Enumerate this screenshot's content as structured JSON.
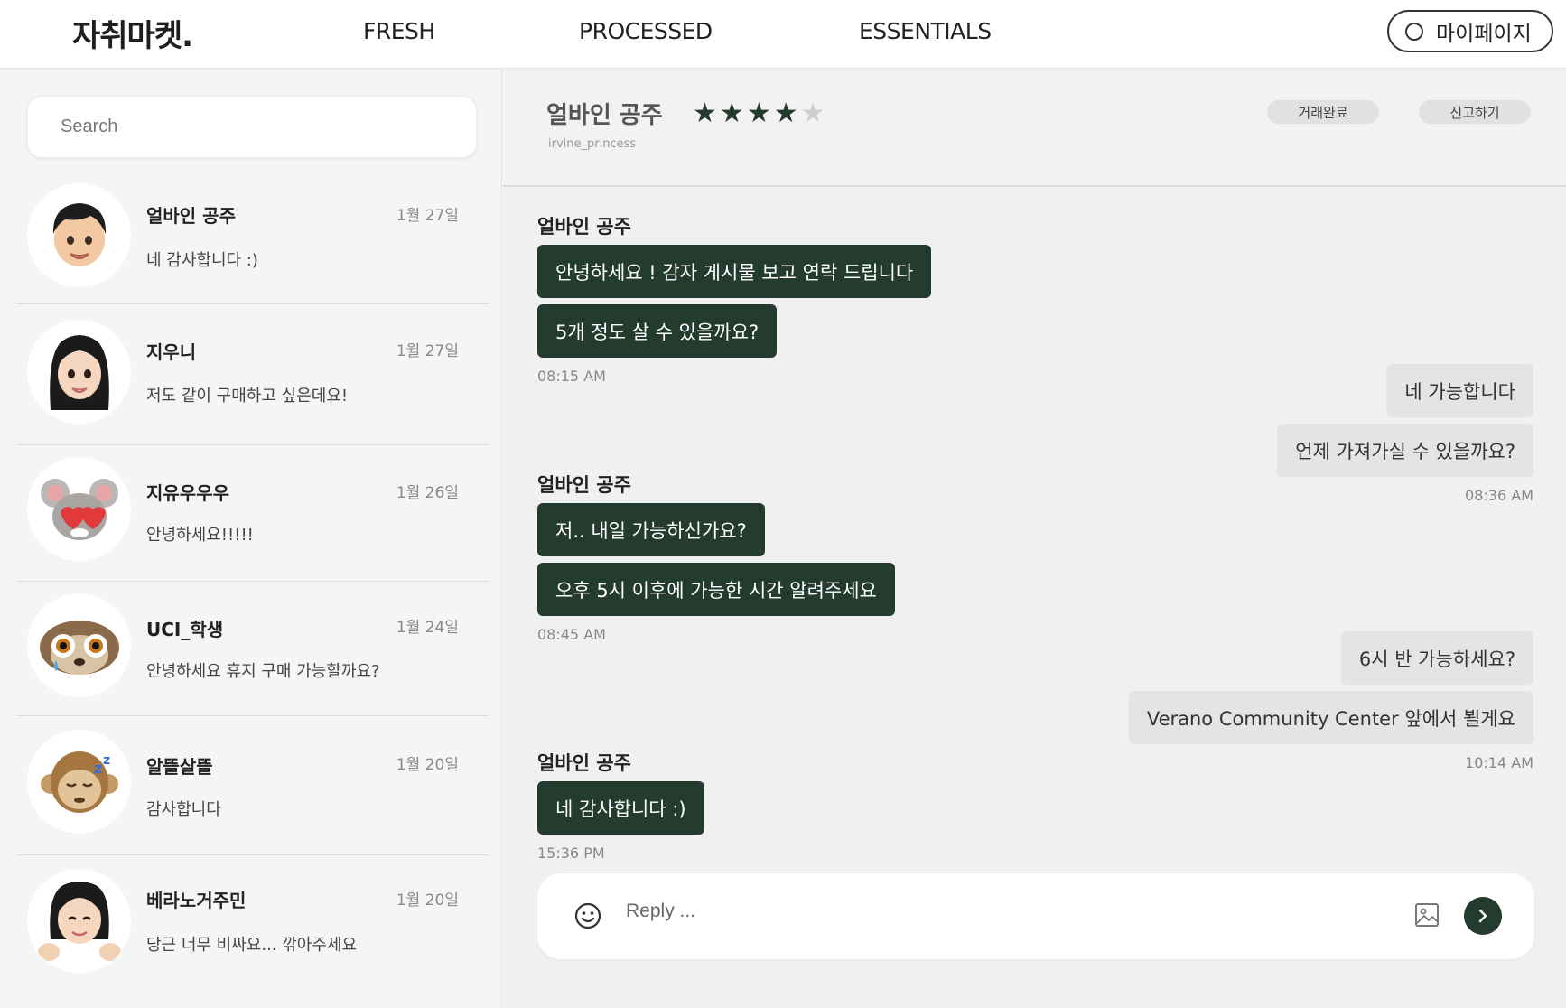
{
  "nav": {
    "logo": "자취마켓.",
    "items": [
      "FRESH",
      "PROCESSED",
      "ESSENTIALS"
    ],
    "mypage_label": "마이페이지"
  },
  "sidebar": {
    "search_placeholder": "Search",
    "conversations": [
      {
        "name": "얼바인 공주",
        "date": "1월 27일",
        "preview": "네 감사합니다 :)"
      },
      {
        "name": "지우니",
        "date": "1월 27일",
        "preview": "저도 같이 구매하고 싶은데요!"
      },
      {
        "name": "지유우우우",
        "date": "1월 26일",
        "preview": "안녕하세요!!!!!"
      },
      {
        "name": "UCI_학생",
        "date": "1월 24일",
        "preview": "안녕하세요 휴지 구매 가능할까요?"
      },
      {
        "name": "알뜰살뜰",
        "date": "1월 20일",
        "preview": "감사합니다"
      },
      {
        "name": "베라노거주민",
        "date": "1월 20일",
        "preview": "당근 너무 비싸요... 깎아주세요"
      }
    ]
  },
  "chat": {
    "header": {
      "name": "얼바인 공주",
      "username": "irvine_princess",
      "rating": 4,
      "rating_max": 5,
      "complete_label": "거래완료",
      "report_label": "신고하기"
    },
    "groups": [
      {
        "sender": "얼바인 공주",
        "messages": [
          "안녕하세요 ! 감자 게시물 보고 연락 드립니다",
          "5개 정도 살 수 있을까요?"
        ],
        "time": "08:15 AM"
      },
      {
        "sender": "",
        "outgoing": true,
        "messages": [
          "네 가능합니다",
          "언제 가져가실 수 있을까요?"
        ],
        "time": "08:36 AM"
      },
      {
        "sender": "얼바인 공주",
        "messages": [
          "저.. 내일 가능하신가요?",
          "오후 5시 이후에 가능한 시간 알려주세요"
        ],
        "time": "08:45 AM"
      },
      {
        "sender": "",
        "outgoing": true,
        "messages": [
          "6시 반 가능하세요?",
          "Verano Community Center 앞에서 뵐게요"
        ],
        "time": "10:14 AM"
      },
      {
        "sender": "얼바인 공주",
        "messages": [
          "네 감사합니다 :)"
        ],
        "time": "15:36 PM"
      }
    ],
    "reply_placeholder": "Reply ..."
  },
  "colors": {
    "accent": "#243b2f",
    "incoming_bubble": "#243b2f",
    "outgoing_bubble": "#e3e5e4",
    "star_on": "#243a2e",
    "star_off": "#cfcfcf"
  },
  "icons": [
    "circle-icon",
    "smile-icon",
    "image-icon",
    "chevron-right-icon"
  ]
}
